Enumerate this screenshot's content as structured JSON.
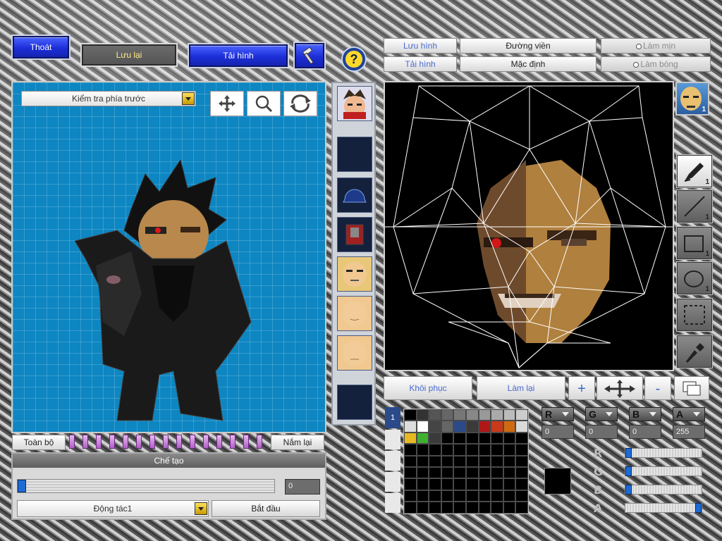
{
  "top_left": {
    "exit_label": "Thoát",
    "save_label": "Lưu lại",
    "reload_label": "Tải hình",
    "hammer_icon": "hammer-icon",
    "help_icon": "help-icon"
  },
  "left_panel": {
    "view_select": "Kiểm tra phía trước",
    "tools": [
      "move-icon",
      "zoom-icon",
      "rotate-icon"
    ],
    "all_label": "Toàn bộ",
    "grab_label": "Nắm lại",
    "frame_marker_count": 15
  },
  "production": {
    "title": "Chế tạo",
    "frame_value": "0",
    "action_select": "Động tác1",
    "start_label": "Bắt đầu"
  },
  "right_top": {
    "save_label": "Lưu hình",
    "reload_label": "Tải hình",
    "outline_label": "Đường viền",
    "default_label": "Mặc định",
    "smooth_label": "Làm mịn",
    "gloss_label": "Làm bóng"
  },
  "right_tools": {
    "pen_count": "1",
    "line_count": "1",
    "rect_count": "1",
    "ellipse_count": "1",
    "face_badge": "1"
  },
  "canvas_controls": {
    "restore_label": "Khôi phục",
    "redo_label": "Làm lại",
    "plus_label": "+",
    "minus_label": "-"
  },
  "color": {
    "r_label": "R",
    "g_label": "G",
    "b_label": "B",
    "a_label": "A",
    "r_value": "0",
    "g_value": "0",
    "b_value": "0",
    "a_value": "255",
    "r_level": 0,
    "g_level": 0,
    "b_level": 0,
    "a_level": 1,
    "palette_tab": "1",
    "current_color": "#000000",
    "swatches": [
      "#000000",
      "#333333",
      "#555555",
      "#666666",
      "#777777",
      "#888888",
      "#999999",
      "#aaaaaa",
      "#bbbbbb",
      "#cccccc",
      "#dddddd",
      "#ffffff",
      "#444444",
      "#666666",
      "#2c4a8a",
      "#3a3a3a",
      "#b01818",
      "#c83a1a",
      "#d06a10",
      "#d9d9d9",
      "#e8b820",
      "#40b030",
      "#3a3a3a"
    ]
  }
}
